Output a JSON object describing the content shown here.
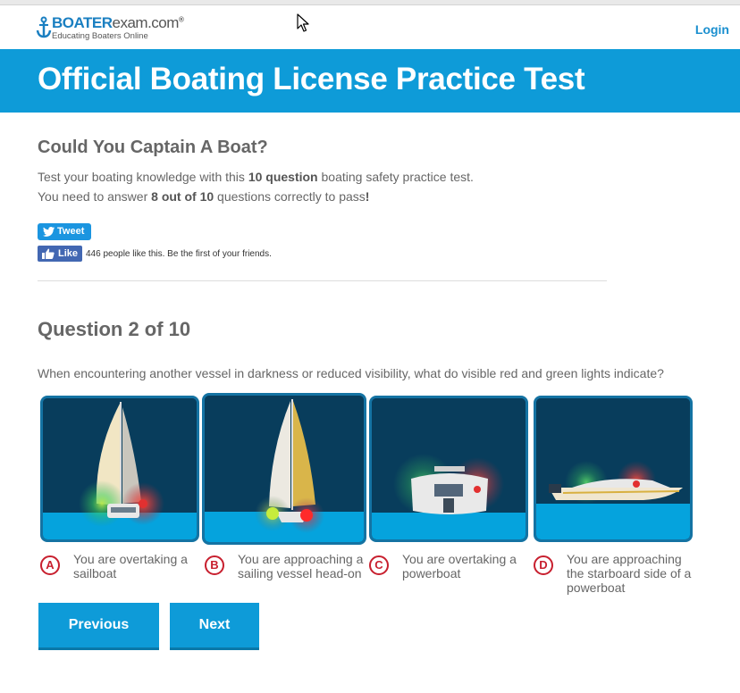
{
  "header": {
    "logo_brand_bold": "BOATER",
    "logo_brand_rest": "exam.com",
    "logo_reg": "®",
    "logo_tagline": "Educating Boaters Online",
    "login_label": "Login"
  },
  "banner": {
    "title": "Official Boating License Practice Test"
  },
  "intro": {
    "heading": "Could You Captain A Boat?",
    "line1_pre": "Test your boating knowledge with this ",
    "line1_bold": "10 question",
    "line1_post": " boating safety practice test.",
    "line2_pre": "You need to answer ",
    "line2_bold": "8 out of 10",
    "line2_post": " questions correctly to pass",
    "line2_end": "!"
  },
  "social": {
    "tweet_label": "Tweet",
    "like_label": "Like",
    "like_text": "446 people like this. Be the first of your friends."
  },
  "question": {
    "title": "Question 2 of 10",
    "text": "When encountering another vessel in darkness or reduced visibility, what do visible red and green lights indicate?",
    "options": [
      {
        "letter": "A",
        "text": "You are overtaking a sailboat"
      },
      {
        "letter": "B",
        "text": "You are approaching a sailing vessel head-on"
      },
      {
        "letter": "C",
        "text": "You are overtaking a powerboat"
      },
      {
        "letter": "D",
        "text": "You are approaching the starboard side of a powerboat"
      }
    ]
  },
  "nav": {
    "previous_label": "Previous",
    "next_label": "Next"
  },
  "colors": {
    "brand_blue": "#0e9bd8",
    "card_bg": "#083d5c",
    "option_red": "#c8202f"
  }
}
